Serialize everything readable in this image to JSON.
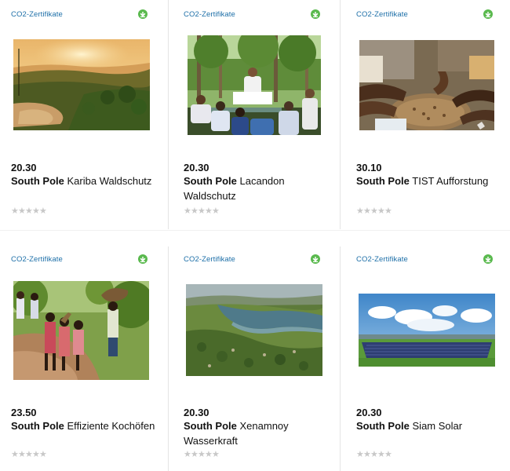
{
  "colors": {
    "category_text": "#1d6fa8",
    "eco_badge": "#59b94d",
    "star_empty": "#c8c8c8"
  },
  "products": [
    {
      "category": "CO2-Zertifikate",
      "badge_icon": "leaf-badge-icon",
      "image": "sunset-river-landscape",
      "price": "20.30",
      "brand": "South Pole",
      "name": "Kariba Waldschutz",
      "rating": 0
    },
    {
      "category": "CO2-Zertifikate",
      "badge_icon": "leaf-badge-icon",
      "image": "people-meeting-in-forest",
      "price": "20.30",
      "brand": "South Pole",
      "name": "Lacandon Waldschutz",
      "rating": 0
    },
    {
      "category": "CO2-Zertifikate",
      "badge_icon": "leaf-badge-icon",
      "image": "hands-with-seeds",
      "price": "30.10",
      "brand": "South Pole",
      "name": "TIST Aufforstung",
      "rating": 0
    },
    {
      "category": "CO2-Zertifikate",
      "badge_icon": "leaf-badge-icon",
      "image": "children-carrying-firewood",
      "price": "23.50",
      "brand": "South Pole",
      "name": "Effiziente Kochöfen",
      "rating": 0
    },
    {
      "category": "CO2-Zertifikate",
      "badge_icon": "leaf-badge-icon",
      "image": "aerial-river-valley",
      "price": "20.30",
      "brand": "South Pole",
      "name": "Xenamnoy Wasserkraft",
      "rating": 0
    },
    {
      "category": "CO2-Zertifikate",
      "badge_icon": "leaf-badge-icon",
      "image": "solar-panel-field",
      "price": "20.30",
      "brand": "South Pole",
      "name": "Siam Solar",
      "rating": 0
    }
  ]
}
